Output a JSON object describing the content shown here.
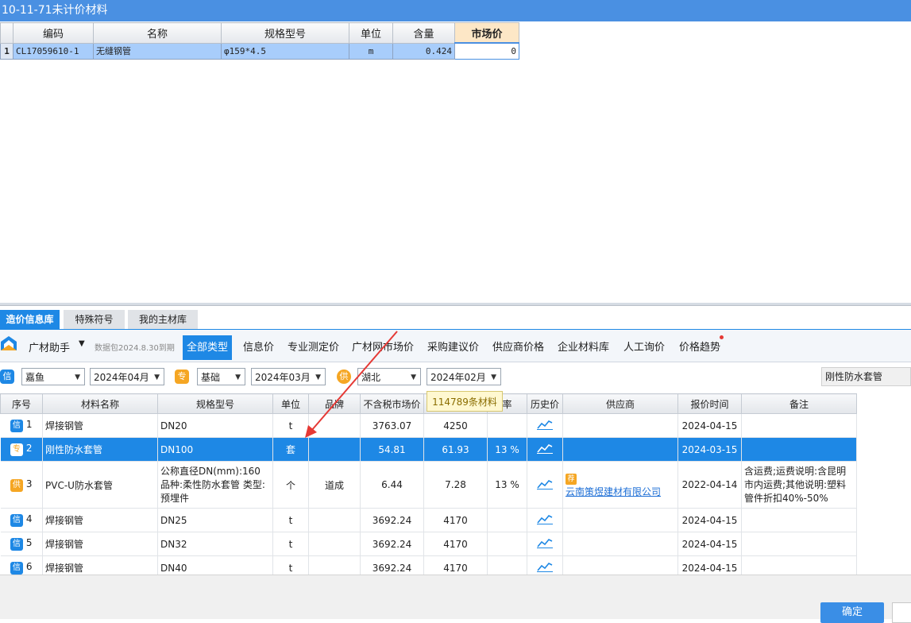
{
  "window": {
    "title": "10-11-71未计价材料"
  },
  "top_table": {
    "headers": [
      "编码",
      "名称",
      "规格型号",
      "单位",
      "含量",
      "市场价"
    ],
    "rows": [
      {
        "row_no": "1",
        "code": "CL17059610-1",
        "name": "无缝钢管",
        "spec": "φ159*4.5",
        "unit": "m",
        "content": "0.424",
        "price": "0"
      }
    ]
  },
  "bottom_tabs": [
    "造价信息库",
    "特殊符号",
    "我的主材库"
  ],
  "toolbar": {
    "brand": "广材助手",
    "brand_caret": "▼",
    "data_package": "数据包2024.8.30到期",
    "categories": [
      "全部类型",
      "信息价",
      "专业测定价",
      "广材网市场价",
      "采购建议价",
      "供应商价格",
      "企业材料库",
      "人工询价",
      "价格趋势"
    ]
  },
  "filters": {
    "xin_badge": "信",
    "xin_region": "嘉鱼",
    "xin_period": "2024年04月",
    "zhuan_badge": "专",
    "zhuan_type": "基础",
    "zhuan_period": "2024年03月",
    "gong_badge": "供",
    "gong_region": "湖北",
    "gong_period": "2024年02月",
    "search_value": "刚性防水套管"
  },
  "tooltip": "114789条材料",
  "main_table": {
    "headers": [
      "序号",
      "材料名称",
      "规格型号",
      "单位",
      "品牌",
      "不含税市场价",
      "",
      "率",
      "历史价",
      "供应商",
      "报价时间",
      "备注"
    ],
    "rows": [
      {
        "tag": "信",
        "no": "1",
        "name": "焊接钢管",
        "spec": "DN20",
        "unit": "t",
        "brand": "",
        "price_ex": "3763.07",
        "price_in": "4250",
        "rate": "",
        "supplier_tag": "",
        "supplier": "",
        "date": "2024-04-15",
        "note": ""
      },
      {
        "tag": "专",
        "no": "2",
        "name": "刚性防水套管",
        "spec": "DN100",
        "unit": "套",
        "brand": "",
        "price_ex": "54.81",
        "price_in": "61.93",
        "rate": "13 %",
        "supplier_tag": "",
        "supplier": "",
        "date": "2024-03-15",
        "note": ""
      },
      {
        "tag": "供",
        "no": "3",
        "name": "PVC-U防水套管",
        "spec": "公称直径DN(mm):160 品种:柔性防水套管 类型:预埋件",
        "unit": "个",
        "brand": "道成",
        "price_ex": "6.44",
        "price_in": "7.28",
        "rate": "13 %",
        "supplier_tag": "荐",
        "supplier": "云南策煜建材有限公司",
        "date": "2022-04-14",
        "note": "含运费;运费说明:含昆明市内运费;其他说明:塑料管件折扣40%-50%"
      },
      {
        "tag": "信",
        "no": "4",
        "name": "焊接钢管",
        "spec": "DN25",
        "unit": "t",
        "brand": "",
        "price_ex": "3692.24",
        "price_in": "4170",
        "rate": "",
        "supplier_tag": "",
        "supplier": "",
        "date": "2024-04-15",
        "note": ""
      },
      {
        "tag": "信",
        "no": "5",
        "name": "焊接钢管",
        "spec": "DN32",
        "unit": "t",
        "brand": "",
        "price_ex": "3692.24",
        "price_in": "4170",
        "rate": "",
        "supplier_tag": "",
        "supplier": "",
        "date": "2024-04-15",
        "note": ""
      },
      {
        "tag": "信",
        "no": "6",
        "name": "焊接钢管",
        "spec": "DN40",
        "unit": "t",
        "brand": "",
        "price_ex": "3692.24",
        "price_in": "4170",
        "rate": "",
        "supplier_tag": "",
        "supplier": "",
        "date": "2024-04-15",
        "note": ""
      }
    ]
  },
  "buttons": {
    "ok": "确定"
  },
  "colors": {
    "accent": "#1e88e5",
    "title_bar": "#4a90e2",
    "badge_orange": "#f5a623",
    "arrow_red": "#e53935"
  }
}
